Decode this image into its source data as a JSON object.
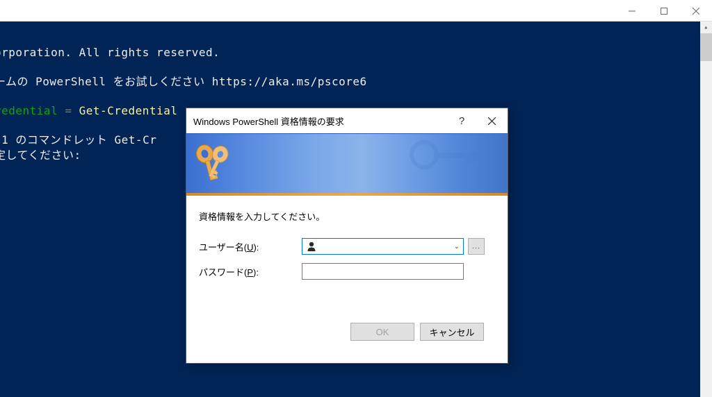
{
  "terminal": {
    "line1": "orporation. All rights reserved.",
    "line2_prefix": "ームの PowerShell をお試しください ",
    "line2_url": "https://aka.ms/pscore6",
    "line3_var": "redential",
    "line3_eq": " = ",
    "line3_cmd": "Get-Credential",
    "line4": " 1 のコマンドレット Get-Cr",
    "line5": "定してください:"
  },
  "dialog": {
    "title": "Windows PowerShell 資格情報の要求",
    "instruction": "資格情報を入力してください。",
    "username_label_prefix": "ユーザー名(",
    "username_label_key": "U",
    "username_label_suffix": "):",
    "password_label_prefix": "パスワード(",
    "password_label_key": "P",
    "password_label_suffix": "):",
    "username_value": "",
    "password_value": "",
    "ok_label": "OK",
    "cancel_label": "キャンセル",
    "browse_text": "..."
  }
}
